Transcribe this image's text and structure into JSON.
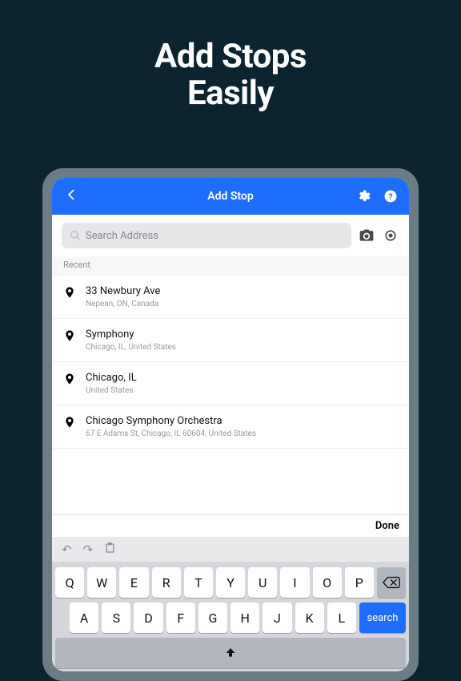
{
  "promo": {
    "line1": "Add Stops",
    "line2": "Easily"
  },
  "header": {
    "title": "Add Stop",
    "back_aria": "Back",
    "settings_aria": "Settings",
    "help_aria": "Help"
  },
  "search": {
    "placeholder": "Search Address",
    "camera_aria": "Camera",
    "locate_aria": "Use current location"
  },
  "section_label": "Recent",
  "recent": [
    {
      "title": "33 Newbury Ave",
      "sub": "Nepean, ON, Canada"
    },
    {
      "title": "Symphony",
      "sub": "Chicago, IL, United States"
    },
    {
      "title": "Chicago, IL",
      "sub": "United States"
    },
    {
      "title": "Chicago Symphony Orchestra",
      "sub": "67 E Adams St, Chicago, IL 60604, United States"
    }
  ],
  "keyboard": {
    "done": "Done",
    "row1": [
      "Q",
      "W",
      "E",
      "R",
      "T",
      "Y",
      "U",
      "I",
      "O",
      "P"
    ],
    "row2": [
      "A",
      "S",
      "D",
      "F",
      "G",
      "H",
      "J",
      "K",
      "L"
    ],
    "search_label": "search"
  }
}
